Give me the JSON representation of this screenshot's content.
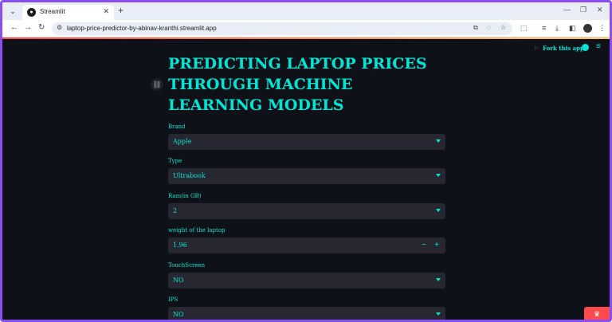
{
  "browser": {
    "tab_title": "Streamlit",
    "tab_favicon_glyph": "●",
    "new_tab_label": "+",
    "url": "laptop-price-predictor-by-abinav-kranthi.streamlit.app"
  },
  "app": {
    "fork_label": "Fork this app",
    "title": "PREDICTING LAPTOP PRICES THROUGH MACHINE LEARNING MODELS",
    "fields": [
      {
        "label": "Brand",
        "value": "Apple"
      },
      {
        "label": "Type",
        "value": "Ultrabook"
      },
      {
        "label": "Ram(in GB)",
        "value": "2"
      },
      {
        "label": "weight of the laptop",
        "value": "1.96"
      },
      {
        "label": "TouchScreen",
        "value": "NO"
      },
      {
        "label": "IPS",
        "value": "NO"
      }
    ],
    "stepper_minus": "−",
    "stepper_plus": "+"
  },
  "colors": {
    "accent": "#00e6d6",
    "background": "#0e1117",
    "input_bg": "#262730",
    "frame": "#8a4df0",
    "badge": "#ff4b4b"
  },
  "icons": [
    "tab-menu-icon",
    "close-icon",
    "back-icon",
    "forward-icon",
    "reload-icon",
    "site-info-icon",
    "install-icon",
    "eye-off-icon",
    "star-icon",
    "extensions-icon",
    "download-icon",
    "sidebar-icon",
    "avatar",
    "kebab-icon",
    "github-icon",
    "hamburger-icon",
    "link-icon",
    "crown-icon"
  ]
}
